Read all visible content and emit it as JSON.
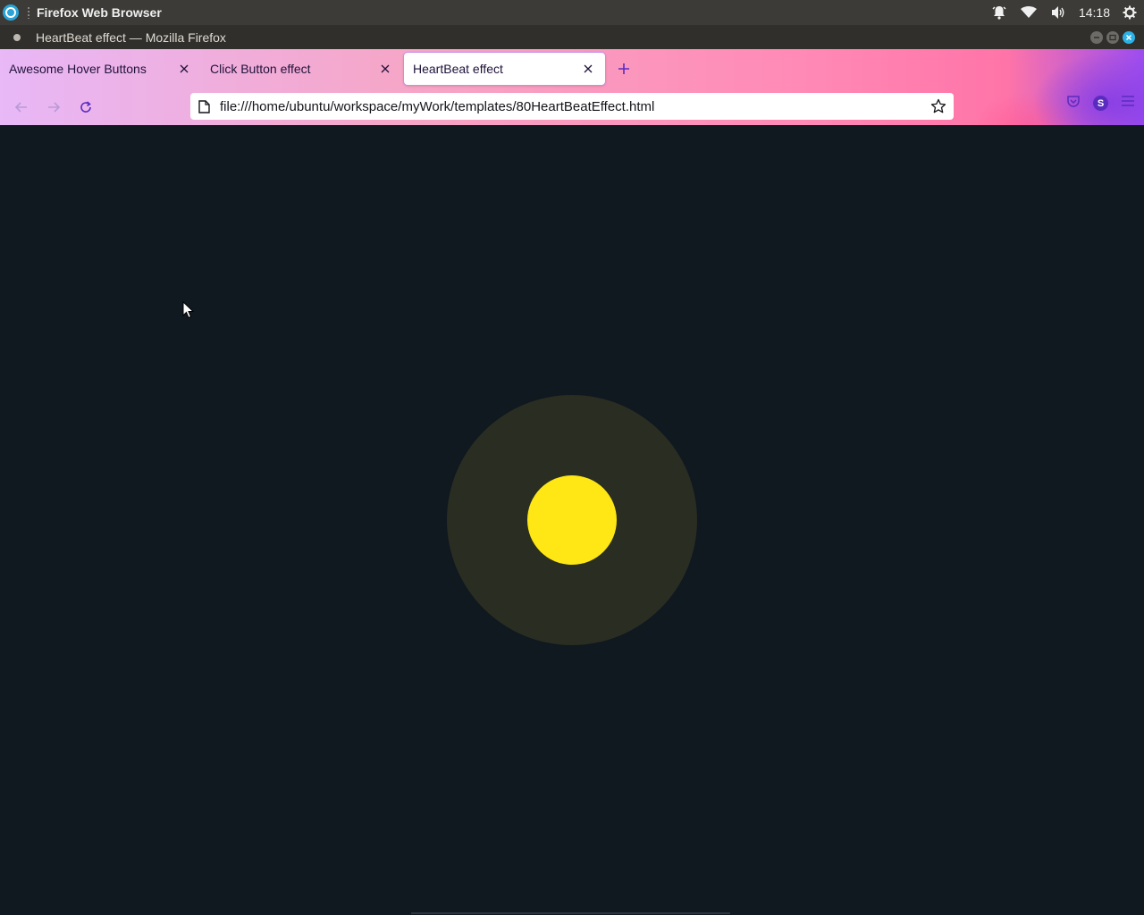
{
  "system_panel": {
    "app_name": "Firefox Web Browser",
    "clock": "14:18",
    "icons": [
      "ubuntu-logo-icon",
      "notification-bell-icon",
      "wifi-icon",
      "volume-icon",
      "settings-gear-icon"
    ]
  },
  "window": {
    "title": "HeartBeat effect — Mozilla Firefox"
  },
  "tabs": [
    {
      "label": "Awesome Hover Buttons",
      "active": false
    },
    {
      "label": "Click Button effect",
      "active": false
    },
    {
      "label": "HeartBeat effect",
      "active": true
    }
  ],
  "navigation": {
    "url": "file:///home/ubuntu/workspace/myWork/templates/80HeartBeatEffect.html",
    "profile_initial": "S"
  },
  "page": {
    "background_color": "#101820",
    "ring_color": "#2a2d21",
    "heart_color": "#fee715"
  },
  "colors": {
    "accent": "#5b2bbf",
    "os_accent": "#2aa3d6"
  }
}
